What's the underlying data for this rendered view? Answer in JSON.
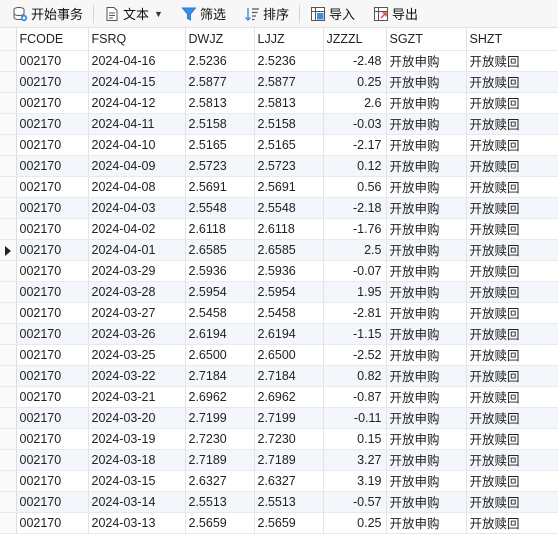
{
  "toolbar": {
    "begin_tx_label": "开始事务",
    "text_label": "文本",
    "filter_label": "筛选",
    "sort_label": "排序",
    "import_label": "导入",
    "export_label": "导出"
  },
  "table": {
    "columns": [
      "FCODE",
      "FSRQ",
      "DWJZ",
      "LJJZ",
      "JZZZL",
      "SGZT",
      "SHZT"
    ],
    "current_row_index": 10,
    "rows": [
      [
        "002170",
        "2024-04-16",
        "2.5236",
        "2.5236",
        "-2.48",
        "开放申购",
        "开放赎回"
      ],
      [
        "002170",
        "2024-04-15",
        "2.5877",
        "2.5877",
        "0.25",
        "开放申购",
        "开放赎回"
      ],
      [
        "002170",
        "2024-04-12",
        "2.5813",
        "2.5813",
        "2.6",
        "开放申购",
        "开放赎回"
      ],
      [
        "002170",
        "2024-04-11",
        "2.5158",
        "2.5158",
        "-0.03",
        "开放申购",
        "开放赎回"
      ],
      [
        "002170",
        "2024-04-10",
        "2.5165",
        "2.5165",
        "-2.17",
        "开放申购",
        "开放赎回"
      ],
      [
        "002170",
        "2024-04-09",
        "2.5723",
        "2.5723",
        "0.12",
        "开放申购",
        "开放赎回"
      ],
      [
        "002170",
        "2024-04-08",
        "2.5691",
        "2.5691",
        "0.56",
        "开放申购",
        "开放赎回"
      ],
      [
        "002170",
        "2024-04-03",
        "2.5548",
        "2.5548",
        "-2.18",
        "开放申购",
        "开放赎回"
      ],
      [
        "002170",
        "2024-04-02",
        "2.6118",
        "2.6118",
        "-1.76",
        "开放申购",
        "开放赎回"
      ],
      [
        "002170",
        "2024-04-01",
        "2.6585",
        "2.6585",
        "2.5",
        "开放申购",
        "开放赎回"
      ],
      [
        "002170",
        "2024-03-29",
        "2.5936",
        "2.5936",
        "-0.07",
        "开放申购",
        "开放赎回"
      ],
      [
        "002170",
        "2024-03-28",
        "2.5954",
        "2.5954",
        "1.95",
        "开放申购",
        "开放赎回"
      ],
      [
        "002170",
        "2024-03-27",
        "2.5458",
        "2.5458",
        "-2.81",
        "开放申购",
        "开放赎回"
      ],
      [
        "002170",
        "2024-03-26",
        "2.6194",
        "2.6194",
        "-1.15",
        "开放申购",
        "开放赎回"
      ],
      [
        "002170",
        "2024-03-25",
        "2.6500",
        "2.6500",
        "-2.52",
        "开放申购",
        "开放赎回"
      ],
      [
        "002170",
        "2024-03-22",
        "2.7184",
        "2.7184",
        "0.82",
        "开放申购",
        "开放赎回"
      ],
      [
        "002170",
        "2024-03-21",
        "2.6962",
        "2.6962",
        "-0.87",
        "开放申购",
        "开放赎回"
      ],
      [
        "002170",
        "2024-03-20",
        "2.7199",
        "2.7199",
        "-0.11",
        "开放申购",
        "开放赎回"
      ],
      [
        "002170",
        "2024-03-19",
        "2.7230",
        "2.7230",
        "0.15",
        "开放申购",
        "开放赎回"
      ],
      [
        "002170",
        "2024-03-18",
        "2.7189",
        "2.7189",
        "3.27",
        "开放申购",
        "开放赎回"
      ],
      [
        "002170",
        "2024-03-15",
        "2.6327",
        "2.6327",
        "3.19",
        "开放申购",
        "开放赎回"
      ],
      [
        "002170",
        "2024-03-14",
        "2.5513",
        "2.5513",
        "-0.57",
        "开放申购",
        "开放赎回"
      ],
      [
        "002170",
        "2024-03-13",
        "2.5659",
        "2.5659",
        "0.25",
        "开放申购",
        "开放赎回"
      ]
    ]
  },
  "colors": {
    "accent": "#2b78d0",
    "row_alt": "#f3f6fb"
  }
}
